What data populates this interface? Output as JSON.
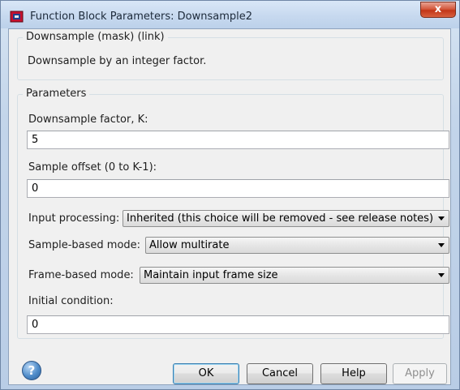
{
  "window": {
    "title": "Function Block Parameters: Downsample2",
    "close_glyph": "x"
  },
  "description": {
    "group_title": "Downsample (mask) (link)",
    "text": "Downsample by an integer  factor."
  },
  "parameters": {
    "group_title": "Parameters",
    "downsample_factor": {
      "label": "Downsample factor, K:",
      "value": "5"
    },
    "sample_offset": {
      "label": "Sample offset (0 to K-1):",
      "value": "0"
    },
    "input_processing": {
      "label": "Input processing:",
      "value": "Inherited (this choice will be removed - see release notes)"
    },
    "sample_based_mode": {
      "label": "Sample-based mode:",
      "value": "Allow multirate"
    },
    "frame_based_mode": {
      "label": "Frame-based mode:",
      "value": "Maintain input frame size"
    },
    "initial_condition": {
      "label": "Initial condition:",
      "value": "0"
    }
  },
  "buttons": {
    "help_glyph": "?",
    "ok": "OK",
    "cancel": "Cancel",
    "help": "Help",
    "apply": "Apply"
  },
  "icons": {
    "app": "simulink-block-icon",
    "close": "close-icon",
    "help": "help-icon"
  },
  "colors": {
    "titlebar": "#c7d9ef",
    "dialog_background": "#f0f0f0",
    "close_button": "#c23618",
    "default_button_border": "#3c7fb1"
  }
}
